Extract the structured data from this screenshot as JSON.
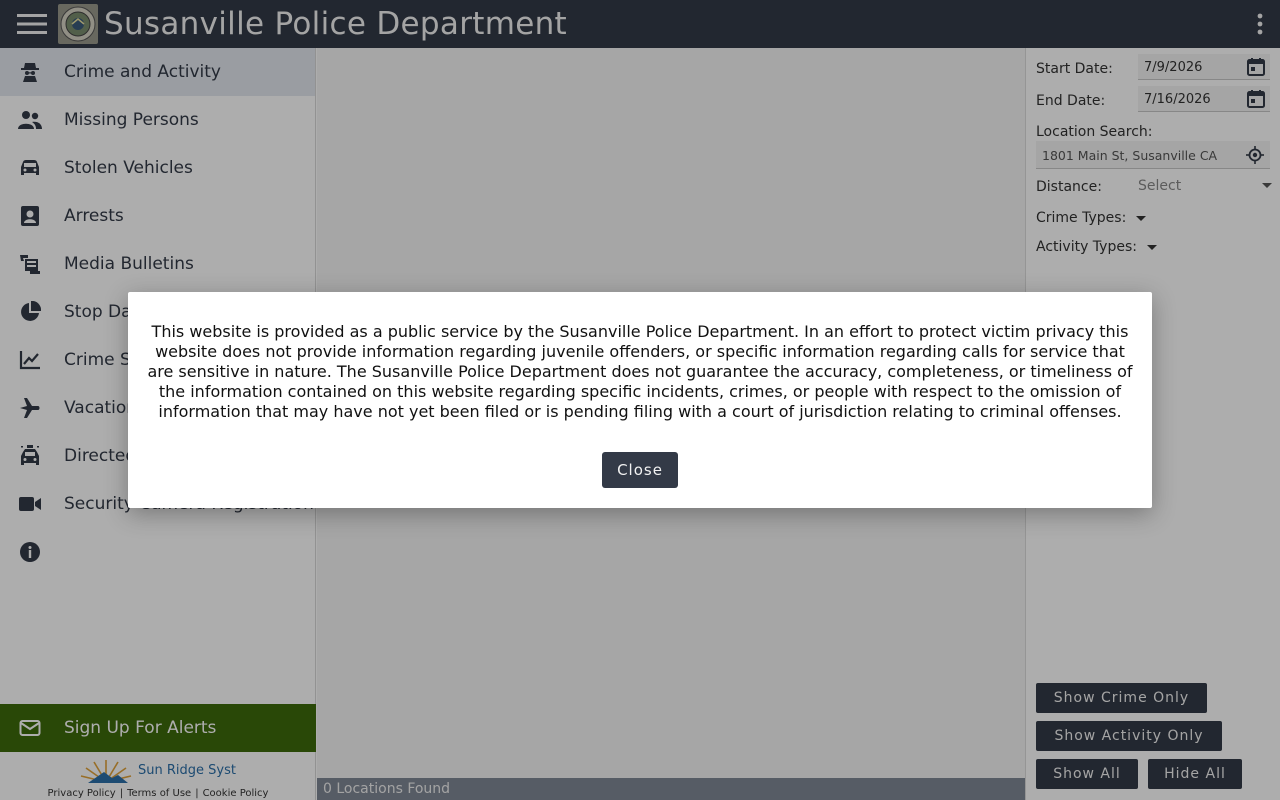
{
  "header": {
    "title": "Susanville Police Department",
    "menu_icon": "hamburger-menu-icon",
    "logo": "department-badge-logo",
    "more_icon": "vertical-dots-icon"
  },
  "sidebar": {
    "items": [
      {
        "label": "Crime and Activity",
        "icon": "detective-icon",
        "active": true
      },
      {
        "label": "Missing Persons",
        "icon": "people-icon"
      },
      {
        "label": "Stolen Vehicles",
        "icon": "car-icon"
      },
      {
        "label": "Arrests",
        "icon": "id-badge-icon"
      },
      {
        "label": "Media Bulletins",
        "icon": "bulletin-icon"
      },
      {
        "label": "Stop Data",
        "icon": "pie-chart-icon"
      },
      {
        "label": "Crime Statistics",
        "icon": "line-chart-icon"
      },
      {
        "label": "Vacation Checks",
        "icon": "airplane-icon"
      },
      {
        "label": "Directed Patrol",
        "icon": "patrol-car-icon"
      },
      {
        "label": "Security Camera Registration",
        "icon": "video-camera-icon"
      },
      {
        "label": "",
        "icon": "info-icon"
      }
    ],
    "alerts_label": "Sign Up For Alerts",
    "vendor_name": "Sun Ridge Syst",
    "footer_links": [
      "Privacy Policy",
      "Terms of Use",
      "Cookie Policy"
    ]
  },
  "filters": {
    "start_label": "Start Date:",
    "start_value": "7/9/2026",
    "end_label": "End Date:",
    "end_value": "7/16/2026",
    "location_label": "Location Search:",
    "location_value": "1801 Main St, Susanville CA",
    "distance_label": "Distance:",
    "distance_placeholder": "Select",
    "crime_types_label": "Crime Types:",
    "activity_types_label": "Activity Types:"
  },
  "buttons": {
    "crime_only": "Show Crime Only",
    "activity_only": "Show Activity Only",
    "show_all": "Show All",
    "hide_all": "Hide All"
  },
  "map": {
    "status": "0 Locations Found"
  },
  "modal": {
    "text": "This website is provided as a public service by the Susanville Police Department. In an effort to protect victim privacy this website does not provide information regarding juvenile offenders, or specific information regarding calls for service that are sensitive in nature. The Susanville Police Department does not guarantee the accuracy, completeness, or timeliness of the information contained on this website regarding specific incidents, crimes, or people with respect to the omission of information that may have not yet been filed or is pending filing with a court of jurisdiction relating to criminal offenses.",
    "close_label": "Close"
  },
  "colors": {
    "header_bg": "#333a47",
    "alerts_bg": "#3d6a0b",
    "active_item_bg": "#e3e8ef",
    "button_bg": "#333a47"
  }
}
